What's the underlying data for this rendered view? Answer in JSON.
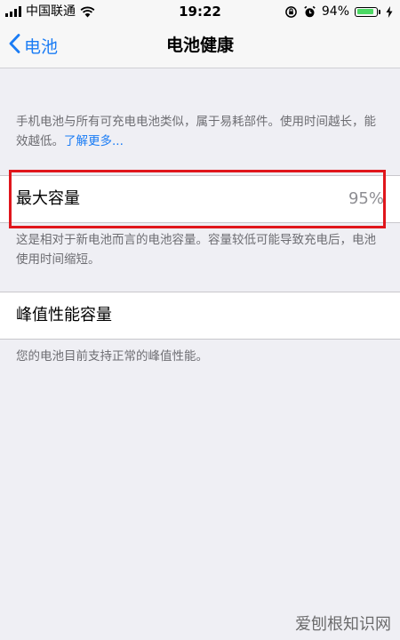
{
  "status_bar": {
    "carrier": "中国联通",
    "time": "19:22",
    "battery_percent_text": "94%",
    "battery_level": 0.94,
    "icons": [
      "signal-icon",
      "wifi-icon",
      "rotation-lock-icon",
      "alarm-icon",
      "battery-icon",
      "charging-icon"
    ]
  },
  "nav": {
    "back_label": "电池",
    "title": "电池健康"
  },
  "intro": {
    "text": "手机电池与所有可充电电池类似，属于易耗部件。使用时间越长，能效越低。",
    "link": "了解更多..."
  },
  "max_capacity": {
    "label": "最大容量",
    "value": "95%",
    "description": "这是相对于新电池而言的电池容量。容量较低可能导致充电后，电池使用时间缩短。"
  },
  "peak_performance": {
    "label": "峰值性能容量",
    "description": "您的电池目前支持正常的峰值性能。"
  },
  "watermark": "爱刨根知识网",
  "colors": {
    "accent": "#1a7cf5",
    "highlight": "#e0161c",
    "battery_fill": "#4cd964"
  }
}
